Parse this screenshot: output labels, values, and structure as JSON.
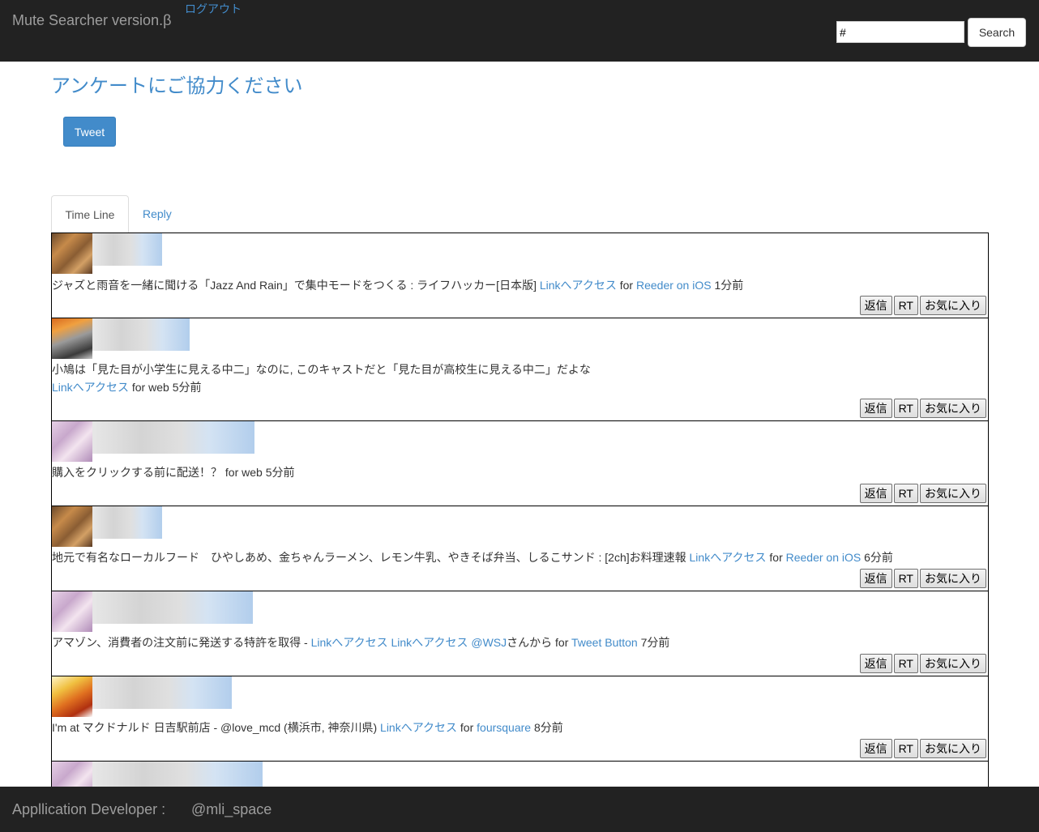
{
  "header": {
    "brand": "Mute Searcher version.β",
    "logout_label": "ログアウト",
    "search_value": "#",
    "search_button_label": "Search"
  },
  "survey": {
    "title": "アンケートにご協力ください",
    "tweet_button_label": "Tweet"
  },
  "tabs": [
    {
      "label": "Time Line",
      "active": true
    },
    {
      "label": "Reply",
      "active": false
    }
  ],
  "actions": {
    "reply_label": "返信",
    "retweet_label": "RT",
    "favorite_label": "お気に入り"
  },
  "timeline": [
    {
      "text": "ジャズと雨音を一緒に聞ける「Jazz And Rain」で集中モードをつくる : ライフハッカー[日本版]",
      "links": [
        "Linkへアクセス"
      ],
      "for_label": "for",
      "via": "Reeder on iOS",
      "time": "1分前"
    },
    {
      "text": "小鳩は「見た目が小学生に見える中二」なのに, このキャストだと「見た目が高校生に見える中二」だよな",
      "links": [
        "Linkへアクセス"
      ],
      "for_label": "for",
      "via": "web",
      "time": "5分前"
    },
    {
      "text": "購入をクリックする前に配送！？",
      "for_label": "for",
      "via": "web",
      "time": "5分前"
    },
    {
      "text": "地元で有名なローカルフード　ひやしあめ、金ちゃんラーメン、レモン牛乳、やきそば弁当、しるこサンド : [2ch]お料理速報",
      "links": [
        "Linkへアクセス"
      ],
      "for_label": "for",
      "via": "Reeder on iOS",
      "time": "6分前"
    },
    {
      "text": "アマゾン、消費者の注文前に発送する特許を取得 -",
      "links": [
        "Linkへアクセス",
        "Linkへアクセス"
      ],
      "mention": "@WSJ",
      "mention_suffix": "さんから",
      "for_label": "for",
      "via": "Tweet Button",
      "time": "7分前"
    },
    {
      "text": "I'm at マクドナルド 日吉駅前店 - @love_mcd (横浜市, 神奈川県)",
      "links": [
        "Linkへアクセス"
      ],
      "for_label": "for",
      "via": "foursquare",
      "time": "8分前"
    }
  ],
  "footer": {
    "label": "Appllication Developer :",
    "handle": "@mli_space"
  }
}
